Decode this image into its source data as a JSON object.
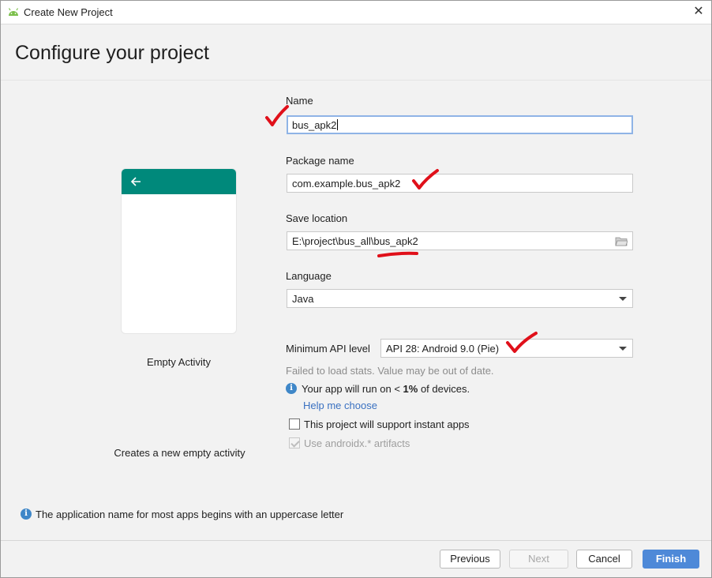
{
  "window": {
    "title": "Create New Project",
    "close_glyph": "✕"
  },
  "page": {
    "heading": "Configure your project"
  },
  "template": {
    "name": "Empty Activity",
    "description": "Creates a new empty activity"
  },
  "form": {
    "name_label": "Name",
    "name_value": "bus_apk2",
    "package_label": "Package name",
    "package_value": "com.example.bus_apk2",
    "location_label": "Save location",
    "location_value": "E:\\project\\bus_all\\bus_apk2",
    "language_label": "Language",
    "language_value": "Java",
    "min_api_label": "Minimum API level",
    "min_api_value": "API 28: Android 9.0 (Pie)",
    "stats_hint": "Failed to load stats. Value may be out of date.",
    "devices_prefix": "Your app will run on < ",
    "devices_percent": "1%",
    "devices_suffix": " of devices.",
    "help_link": "Help me choose",
    "instant_apps_label": "This project will support instant apps",
    "androidx_label": "Use androidx.* artifacts"
  },
  "footer": {
    "info_text": "The application name for most apps begins with an uppercase letter",
    "previous": "Previous",
    "next": "Next",
    "cancel": "Cancel",
    "finish": "Finish"
  },
  "icons": {
    "app": "android-icon",
    "back": "arrow-left-icon",
    "folder": "folder-icon",
    "info": "info-icon"
  },
  "colors": {
    "accent": "#4e89d8",
    "appbar": "#00897b",
    "link": "#3a71c1",
    "annotation": "#e0101a"
  }
}
